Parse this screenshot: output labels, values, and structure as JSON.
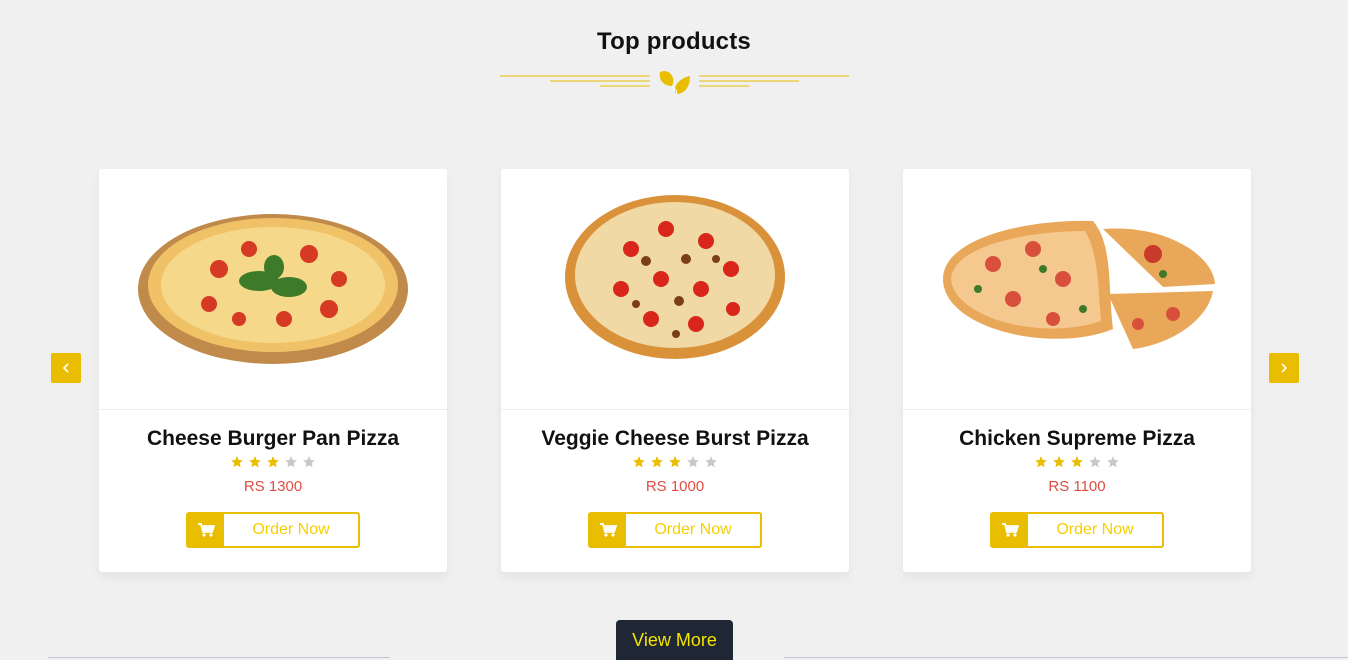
{
  "section": {
    "title": "Top products"
  },
  "colors": {
    "accent": "#e9bd00",
    "price": "#e04d43",
    "button_dark": "#1e2733",
    "star_inactive": "#c8c8c8"
  },
  "icons": {
    "divider": "leaf-icon",
    "prev": "chevron-left-icon",
    "next": "chevron-right-icon",
    "cart": "cart-icon",
    "star": "star-icon"
  },
  "products": [
    {
      "name": "Cheese Burger Pan Pizza",
      "rating": 3,
      "max_rating": 5,
      "price": "RS 1300",
      "order_label": "Order Now"
    },
    {
      "name": "Veggie Cheese Burst Pizza",
      "rating": 3,
      "max_rating": 5,
      "price": "RS 1000",
      "order_label": "Order Now"
    },
    {
      "name": "Chicken Supreme Pizza",
      "rating": 3,
      "max_rating": 5,
      "price": "RS 1100",
      "order_label": "Order Now"
    }
  ],
  "view_more": {
    "label": "View More"
  }
}
